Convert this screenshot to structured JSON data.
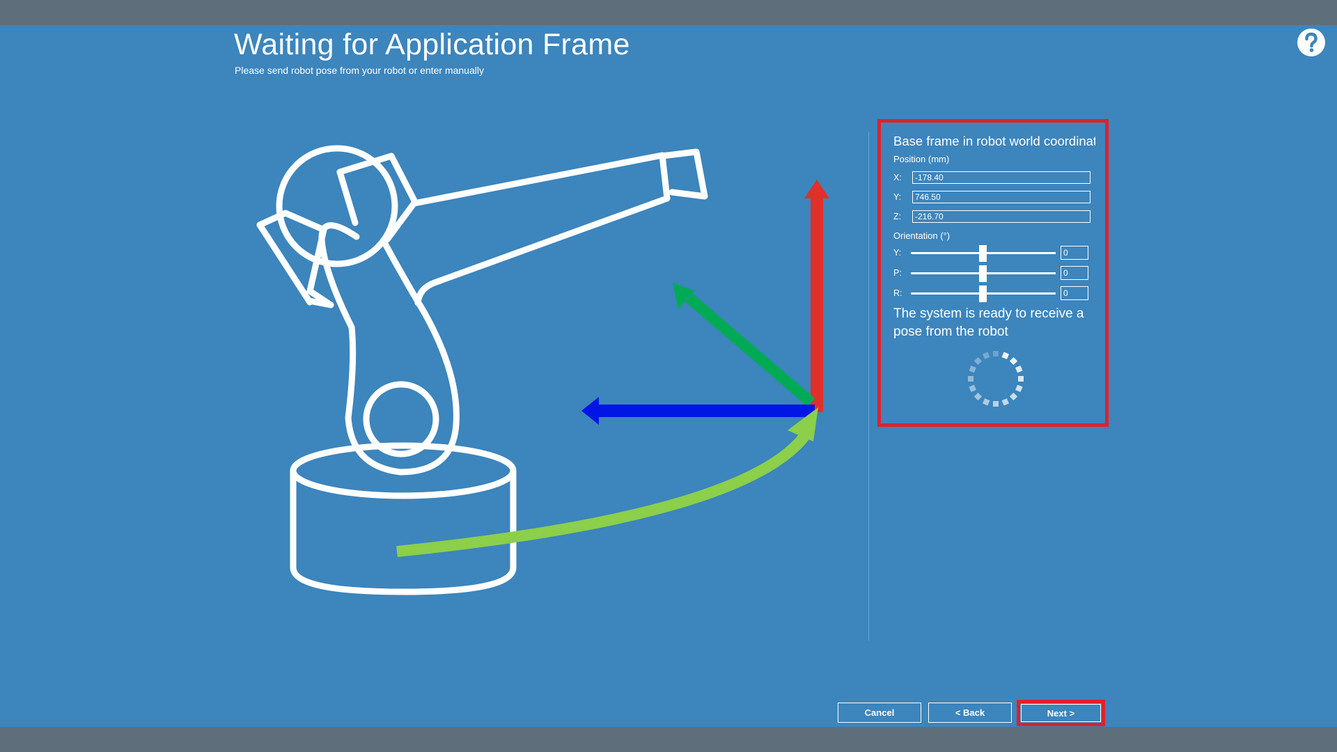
{
  "header": {
    "title": "Waiting for Application Frame",
    "subtitle": "Please send robot pose from your robot or enter manually",
    "help_icon": "help-icon"
  },
  "illustration": {
    "robot_icon": "robot-arm-icon",
    "arrow_colors": {
      "red": "#e0302a",
      "green": "#00aa55",
      "blue": "#0015e6",
      "light_green": "#8ccf4a"
    }
  },
  "panel": {
    "title": "Base frame in robot world coordinates",
    "position_label": "Position (mm)",
    "position": [
      {
        "label": "X:",
        "value": "-178.40"
      },
      {
        "label": "Y:",
        "value": "746.50"
      },
      {
        "label": "Z:",
        "value": "-216.70"
      }
    ],
    "orientation_label": "Orientation (°)",
    "orientation": [
      {
        "label": "Y:",
        "value": "0"
      },
      {
        "label": "P:",
        "value": "0"
      },
      {
        "label": "R:",
        "value": "0"
      }
    ],
    "status": "The system is ready to receive a pose from the robot",
    "highlight_color": "#e0212b"
  },
  "buttons": {
    "cancel": "Cancel",
    "back": "< Back",
    "next": "Next >"
  },
  "colors": {
    "background": "#3c85bd",
    "bars": "#5e6e7a",
    "highlight": "#e0212b"
  }
}
